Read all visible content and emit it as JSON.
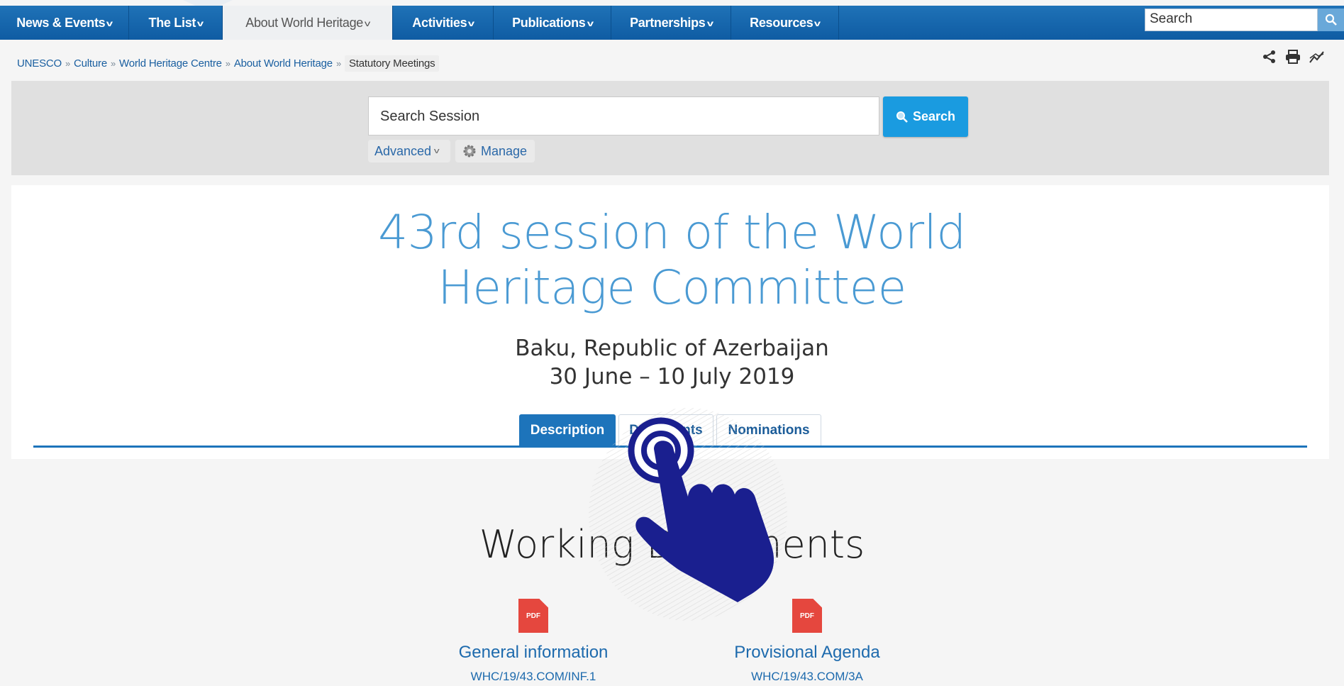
{
  "nav": {
    "items": [
      {
        "label": "News & Events"
      },
      {
        "label": "The List"
      },
      {
        "label": "About World Heritage"
      },
      {
        "label": "Activities"
      },
      {
        "label": "Publications"
      },
      {
        "label": "Partnerships"
      },
      {
        "label": "Resources"
      }
    ],
    "search_value": "Search"
  },
  "breadcrumb": {
    "items": [
      "UNESCO",
      "Culture",
      "World Heritage Centre",
      "About World Heritage"
    ],
    "separator": "»",
    "current": "Statutory Meetings"
  },
  "search_panel": {
    "input_value": "Search Session",
    "search_button": "Search",
    "advanced_label": "Advanced",
    "manage_label": "Manage"
  },
  "session": {
    "title_line1": "43rd session of the World",
    "title_line2": "Heritage Committee",
    "location": "Baku, Republic of Azerbaijan",
    "dates": "30 June – 10 July 2019"
  },
  "tabs": [
    {
      "label": "Description",
      "active": true
    },
    {
      "label": "Documents",
      "active": false
    },
    {
      "label": "Nominations",
      "active": false
    }
  ],
  "working_documents": {
    "heading": "Working Documents",
    "docs": [
      {
        "icon_text": "PDF",
        "name": "General information",
        "code": "WHC/19/43.COM/INF.1"
      },
      {
        "icon_text": "PDF",
        "name": "Provisional Agenda",
        "code": "WHC/19/43.COM/3A"
      }
    ]
  },
  "colors": {
    "nav_blue": "#1665ad",
    "title_blue": "#4a9ad3",
    "accent_button": "#1a9be0",
    "pdf_red": "#e5473e",
    "hand_cursor": "#1a1f8f"
  }
}
